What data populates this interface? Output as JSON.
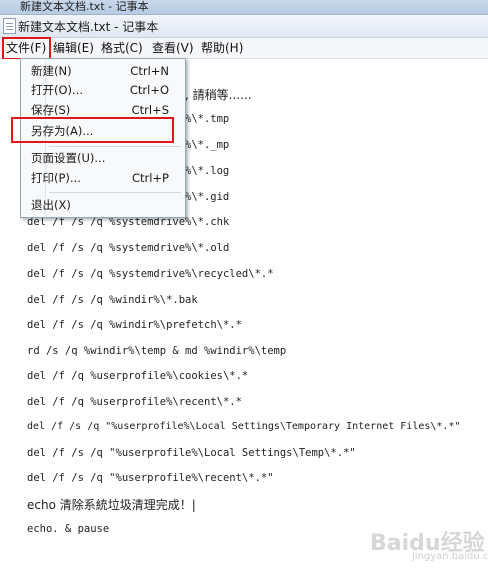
{
  "background_window": {
    "title": "新建文本文档.txt - 记事本"
  },
  "window": {
    "title": "新建文本文档.txt - 记事本"
  },
  "menubar": {
    "items": [
      {
        "label": "文件(F)"
      },
      {
        "label": "编辑(E)"
      },
      {
        "label": "格式(C)"
      },
      {
        "label": "查看(V)"
      },
      {
        "label": "帮助(H)"
      }
    ]
  },
  "file_menu": {
    "items": [
      {
        "label": "新建(N)",
        "shortcut": "Ctrl+N"
      },
      {
        "label": "打开(O)...",
        "shortcut": "Ctrl+O"
      },
      {
        "label": "保存(S)",
        "shortcut": "Ctrl+S"
      },
      {
        "label": "另存为(A)...",
        "shortcut": ""
      },
      {
        "label": "页面设置(U)...",
        "shortcut": ""
      },
      {
        "label": "打印(P)...",
        "shortcut": "Ctrl+P"
      },
      {
        "label": "退出(X)",
        "shortcut": ""
      }
    ]
  },
  "editor": {
    "lines": [
      ", 請稍等......",
      "%\\*.tmp",
      "%\\*._mp",
      "%\\*.log",
      "%\\*.gid",
      "del /f /s /q %systemdrive%\\*.chk",
      "del /f /s /q %systemdrive%\\*.old",
      "del /f /s /q %systemdrive%\\recycled\\*.*",
      "del /f /s /q %windir%\\*.bak",
      "del /f /s /q %windir%\\prefetch\\*.*",
      "rd /s /q %windir%\\temp & md %windir%\\temp",
      "del /f /q %userprofile%\\cookies\\*.*",
      "del /f /q %userprofile%\\recent\\*.*",
      "del /f /s /q \"%userprofile%\\Local Settings\\Temporary Internet Files\\*.*\"",
      "del /f /s /q \"%userprofile%\\Local Settings\\Temp\\*.*\"",
      "del /f /s /q \"%userprofile%\\recent\\*.*\"",
      "echo 清除系統垃圾清理完成！|",
      "echo. & pause"
    ]
  },
  "watermark": {
    "text": "Baidu经验",
    "sub": "jingyan.baidu.com"
  }
}
